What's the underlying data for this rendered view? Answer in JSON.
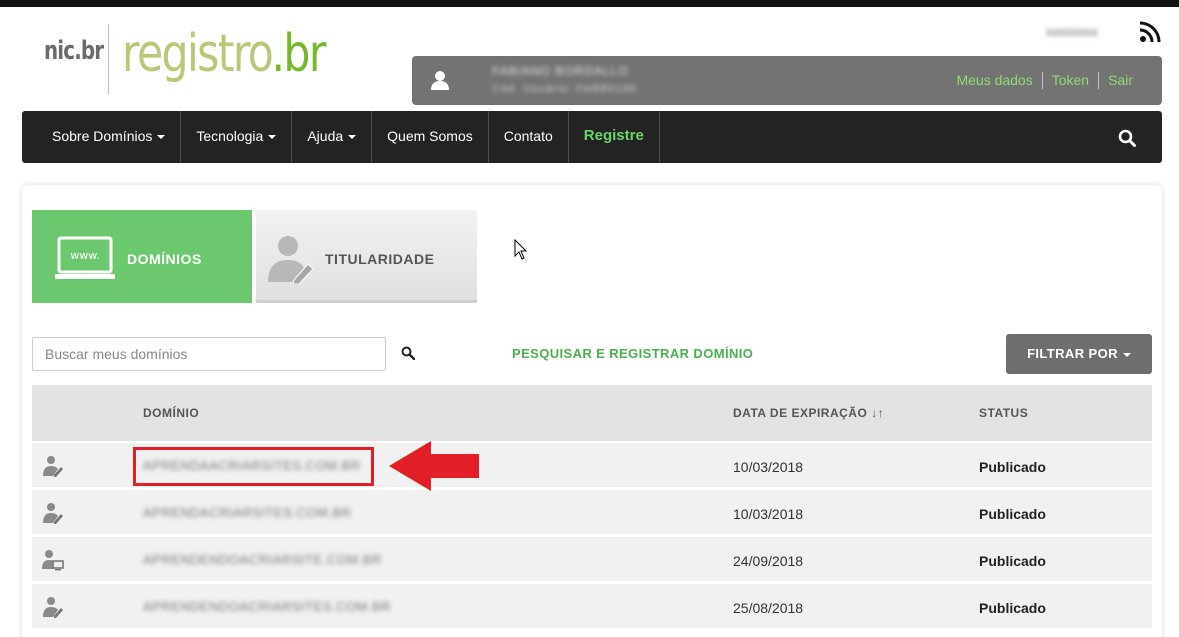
{
  "header": {
    "logo_nic": "nic.br",
    "logo_registro": "registro",
    "logo_br": ".br",
    "top_right_blurred": "xxxxxxxx"
  },
  "user": {
    "name_blurred": "FABIANO BORDALLO",
    "sub_blurred": "Cód. Usuário: FABB0166",
    "links": [
      "Meus dados",
      "Token",
      "Sair"
    ]
  },
  "nav": {
    "items": [
      {
        "label": "Sobre Domínios",
        "dropdown": true
      },
      {
        "label": "Tecnologia",
        "dropdown": true
      },
      {
        "label": "Ajuda",
        "dropdown": true
      },
      {
        "label": "Quem Somos",
        "dropdown": false
      },
      {
        "label": "Contato",
        "dropdown": false
      },
      {
        "label": "Registre",
        "dropdown": false
      }
    ]
  },
  "tabs": {
    "dominios": "DOMÍNIOS",
    "dominios_icon_text": "www.",
    "titularidade": "TITULARIDADE"
  },
  "toolbar": {
    "search_placeholder": "Buscar meus domínios",
    "pesquisar_label": "PESQUISAR E REGISTRAR DOMÍNIO",
    "filtrar_label": "FILTRAR POR"
  },
  "table": {
    "headers": {
      "dominio": "DOMÍNIO",
      "data": "DATA DE EXPIRAÇÃO",
      "sort_icon": "↓↑",
      "status": "STATUS"
    },
    "rows": [
      {
        "domain": "APRENDAACRIARSITES.COM.BR",
        "date": "10/03/2018",
        "status": "Publicado",
        "icon": "user-edit-icon"
      },
      {
        "domain": "APRENDACRIARSITES.COM.BR",
        "date": "10/03/2018",
        "status": "Publicado",
        "icon": "user-edit-icon"
      },
      {
        "domain": "APRENDENDOACRIARSITE.COM.BR",
        "date": "24/09/2018",
        "status": "Publicado",
        "icon": "user-computer-icon"
      },
      {
        "domain": "APRENDENDOACRIARSITES.COM.BR",
        "date": "25/08/2018",
        "status": "Publicado",
        "icon": "user-edit-icon"
      }
    ]
  },
  "colors": {
    "green_tab": "#6cc86f",
    "green_link": "#4cae4f",
    "nav_bg": "#232323",
    "highlight_red": "#e21f26"
  }
}
